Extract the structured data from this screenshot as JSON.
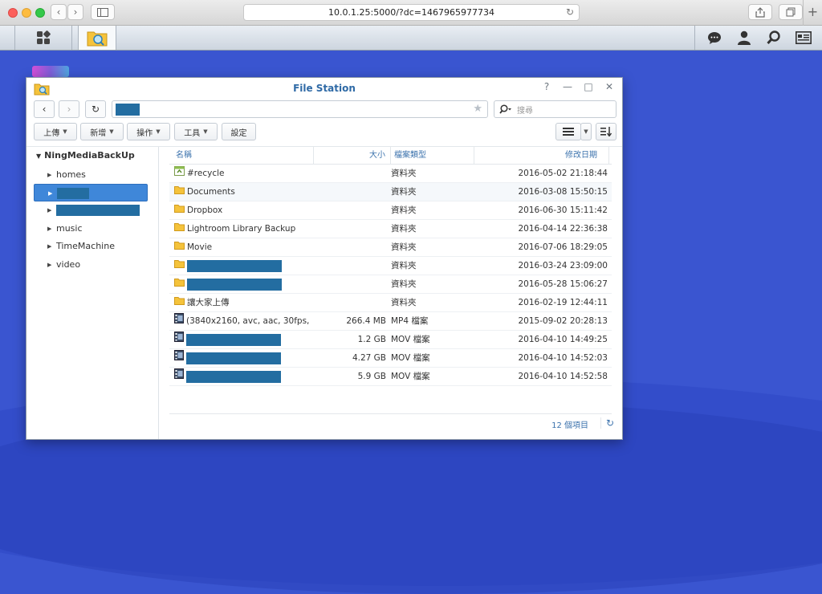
{
  "browser": {
    "url": "10.0.1.25:5000/?dc=1467965977734"
  },
  "window": {
    "title": "File Station"
  },
  "search": {
    "placeholder": "搜尋"
  },
  "toolbar": {
    "upload": "上傳",
    "create": "新增",
    "action": "操作",
    "tools": "工具",
    "settings": "設定"
  },
  "sidebar": {
    "root": "NingMediaBackUp",
    "items": [
      {
        "label": "homes"
      },
      {
        "label": ""
      },
      {
        "label": ""
      },
      {
        "label": "music"
      },
      {
        "label": "TimeMachine"
      },
      {
        "label": "video"
      }
    ]
  },
  "table": {
    "headers": {
      "name": "名稱",
      "size": "大小",
      "type": "檔案類型",
      "date": "修改日期"
    },
    "rows": [
      {
        "name": "#recycle",
        "size": "",
        "type": "資料夾",
        "date": "2016-05-02 21:18:44",
        "icon": "recycle-folder-icon"
      },
      {
        "name": "Documents",
        "size": "",
        "type": "資料夾",
        "date": "2016-03-08 15:50:15",
        "icon": "folder-icon"
      },
      {
        "name": "Dropbox",
        "size": "",
        "type": "資料夾",
        "date": "2016-06-30 15:11:42",
        "icon": "folder-icon"
      },
      {
        "name": "Lightroom Library Backup",
        "size": "",
        "type": "資料夾",
        "date": "2016-04-14 22:36:38",
        "icon": "folder-icon"
      },
      {
        "name": "Movie",
        "size": "",
        "type": "資料夾",
        "date": "2016-07-06 18:29:05",
        "icon": "folder-icon"
      },
      {
        "name": "",
        "size": "",
        "type": "資料夾",
        "date": "2016-03-24 23:09:00",
        "icon": "folder-icon",
        "redacted": true
      },
      {
        "name": "",
        "size": "",
        "type": "資料夾",
        "date": "2016-05-28 15:06:27",
        "icon": "folder-icon",
        "redacted": true
      },
      {
        "name": "讓大家上傳",
        "size": "",
        "type": "資料夾",
        "date": "2016-02-19 12:44:11",
        "icon": "folder-icon"
      },
      {
        "name": "(3840x2160, avc, aac, 30fps, ...",
        "size": "266.4 MB",
        "type": "MP4 檔案",
        "date": "2015-09-02 20:28:13",
        "icon": "video-file-icon"
      },
      {
        "name": "",
        "size": "1.2 GB",
        "type": "MOV 檔案",
        "date": "2016-04-10 14:49:25",
        "icon": "video-file-icon",
        "redacted": true
      },
      {
        "name": "",
        "size": "4.27 GB",
        "type": "MOV 檔案",
        "date": "2016-04-10 14:52:03",
        "icon": "video-file-icon",
        "redacted": true
      },
      {
        "name": "",
        "size": "5.9 GB",
        "type": "MOV 檔案",
        "date": "2016-04-10 14:52:58",
        "icon": "video-file-icon",
        "redacted": true
      }
    ]
  },
  "footer": {
    "count": "12 個項目"
  }
}
